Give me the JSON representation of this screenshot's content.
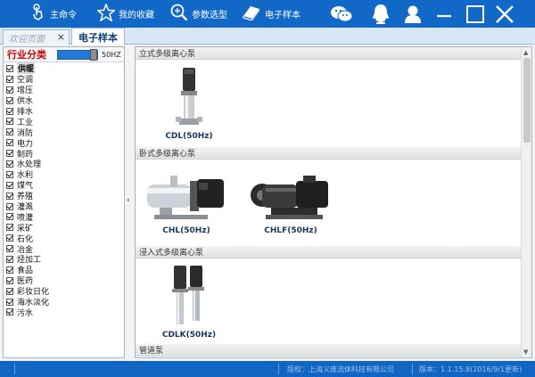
{
  "toolbar": {
    "items": [
      {
        "label": "主命令",
        "icon": "touch-hand-icon"
      },
      {
        "label": "我的收藏",
        "icon": "star-icon"
      },
      {
        "label": "参数选型",
        "icon": "search-icon"
      },
      {
        "label": "电子样本",
        "icon": "book-icon"
      }
    ],
    "right_icons": [
      "wechat-icon",
      "qq-penguin-icon",
      "user-icon",
      "minimize-icon",
      "maximize-icon",
      "close-icon"
    ]
  },
  "tabs": [
    {
      "label": "欢迎页面",
      "closable": true
    },
    {
      "label": "电子样本",
      "active": true
    }
  ],
  "sidebar": {
    "title": "行业分类",
    "frequency": {
      "label": "50HZ",
      "value": 1.0
    },
    "categories": [
      {
        "label": "供暖",
        "checked": true,
        "selected": true
      },
      {
        "label": "空调",
        "checked": true
      },
      {
        "label": "增压",
        "checked": true
      },
      {
        "label": "供水",
        "checked": true
      },
      {
        "label": "排水",
        "checked": true
      },
      {
        "label": "工业",
        "checked": true
      },
      {
        "label": "消防",
        "checked": true
      },
      {
        "label": "电力",
        "checked": true
      },
      {
        "label": "制药",
        "checked": true
      },
      {
        "label": "水处理",
        "checked": true
      },
      {
        "label": "水利",
        "checked": true
      },
      {
        "label": "煤气",
        "checked": true
      },
      {
        "label": "养殖",
        "checked": true
      },
      {
        "label": "灌溉",
        "checked": true
      },
      {
        "label": "喷灌",
        "checked": true
      },
      {
        "label": "采矿",
        "checked": true
      },
      {
        "label": "石化",
        "checked": true
      },
      {
        "label": "冶金",
        "checked": true
      },
      {
        "label": "烃加工",
        "checked": true
      },
      {
        "label": "食品",
        "checked": true
      },
      {
        "label": "医药",
        "checked": true
      },
      {
        "label": "彩妆日化",
        "checked": true
      },
      {
        "label": "海水淡化",
        "checked": true
      },
      {
        "label": "污水",
        "checked": true
      }
    ]
  },
  "collapse_arrow": "‹",
  "sections": [
    {
      "title": "立式多级离心泵",
      "products": [
        {
          "label": "CDL(50Hz)",
          "kind": "vertical"
        }
      ]
    },
    {
      "title": "卧式多级离心泵",
      "products": [
        {
          "label": "CHL(50Hz)",
          "kind": "horizontal-steel"
        },
        {
          "label": "CHLF(50Hz)",
          "kind": "horizontal-dark"
        }
      ]
    },
    {
      "title": "浸入式多级离心泵",
      "products": [
        {
          "label": "CDLK(50Hz)",
          "kind": "immersion"
        }
      ]
    },
    {
      "title": "管道泵",
      "products": []
    }
  ],
  "statusbar": {
    "company": "版权：上海义维流体科技有限公司",
    "version": "版本：1.1.15.8(2016/9/1更新)"
  }
}
